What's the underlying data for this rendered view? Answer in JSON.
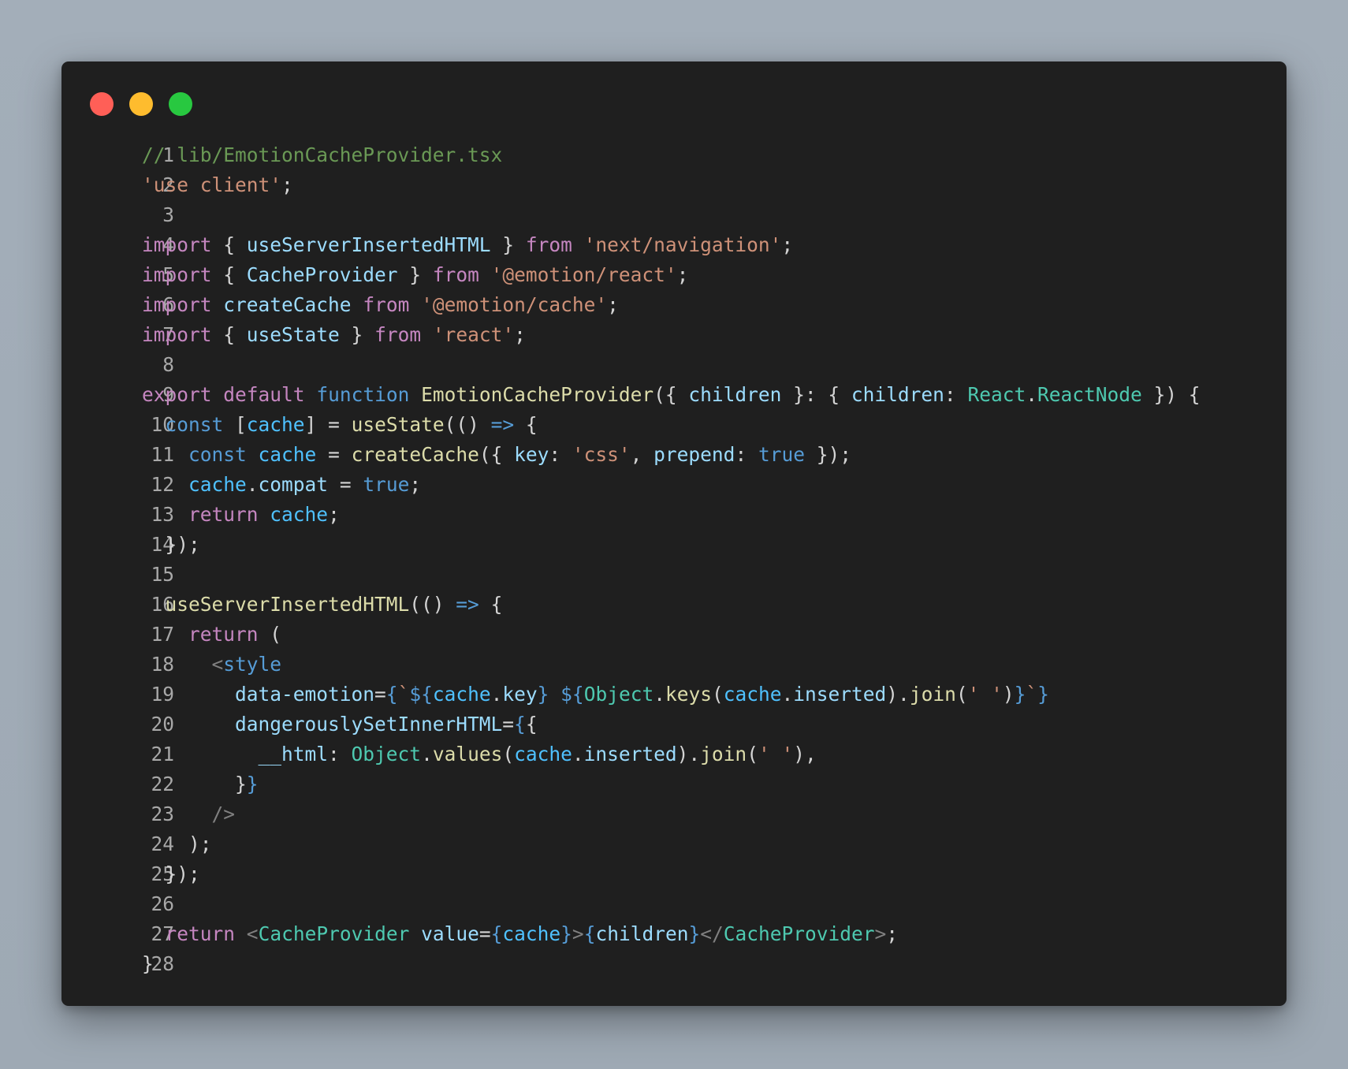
{
  "window": {
    "controls": [
      {
        "name": "close",
        "color": "#ff5f57"
      },
      {
        "name": "minimize",
        "color": "#febc2e"
      },
      {
        "name": "maximize",
        "color": "#28c840"
      }
    ]
  },
  "code": {
    "language": "tsx",
    "lines": [
      {
        "n": "1",
        "tokens": [
          [
            "comment",
            "// lib/EmotionCacheProvider.tsx"
          ]
        ]
      },
      {
        "n": "2",
        "tokens": [
          [
            "string",
            "'use client'"
          ],
          [
            "punct",
            ";"
          ]
        ]
      },
      {
        "n": "3",
        "tokens": []
      },
      {
        "n": "4",
        "tokens": [
          [
            "kw",
            "import"
          ],
          [
            "punct",
            " { "
          ],
          [
            "var",
            "useServerInsertedHTML"
          ],
          [
            "punct",
            " } "
          ],
          [
            "kw",
            "from"
          ],
          [
            "punct",
            " "
          ],
          [
            "string",
            "'next/navigation'"
          ],
          [
            "punct",
            ";"
          ]
        ]
      },
      {
        "n": "5",
        "tokens": [
          [
            "kw",
            "import"
          ],
          [
            "punct",
            " { "
          ],
          [
            "var",
            "CacheProvider"
          ],
          [
            "punct",
            " } "
          ],
          [
            "kw",
            "from"
          ],
          [
            "punct",
            " "
          ],
          [
            "string",
            "'@emotion/react'"
          ],
          [
            "punct",
            ";"
          ]
        ]
      },
      {
        "n": "6",
        "tokens": [
          [
            "kw",
            "import"
          ],
          [
            "punct",
            " "
          ],
          [
            "var",
            "createCache"
          ],
          [
            "punct",
            " "
          ],
          [
            "kw",
            "from"
          ],
          [
            "punct",
            " "
          ],
          [
            "string",
            "'@emotion/cache'"
          ],
          [
            "punct",
            ";"
          ]
        ]
      },
      {
        "n": "7",
        "tokens": [
          [
            "kw",
            "import"
          ],
          [
            "punct",
            " { "
          ],
          [
            "var",
            "useState"
          ],
          [
            "punct",
            " } "
          ],
          [
            "kw",
            "from"
          ],
          [
            "punct",
            " "
          ],
          [
            "string",
            "'react'"
          ],
          [
            "punct",
            ";"
          ]
        ]
      },
      {
        "n": "8",
        "tokens": []
      },
      {
        "n": "9",
        "tokens": [
          [
            "kw",
            "export"
          ],
          [
            "punct",
            " "
          ],
          [
            "kw",
            "default"
          ],
          [
            "punct",
            " "
          ],
          [
            "storage",
            "function"
          ],
          [
            "punct",
            " "
          ],
          [
            "func",
            "EmotionCacheProvider"
          ],
          [
            "punct",
            "({ "
          ],
          [
            "var",
            "children"
          ],
          [
            "punct",
            " }: { "
          ],
          [
            "var",
            "children"
          ],
          [
            "punct",
            ": "
          ],
          [
            "type",
            "React"
          ],
          [
            "punct",
            "."
          ],
          [
            "type",
            "ReactNode"
          ],
          [
            "punct",
            " }) {"
          ]
        ]
      },
      {
        "n": "10",
        "tokens": [
          [
            "punct",
            "  "
          ],
          [
            "storage",
            "const"
          ],
          [
            "punct",
            " ["
          ],
          [
            "const",
            "cache"
          ],
          [
            "punct",
            "] = "
          ],
          [
            "func",
            "useState"
          ],
          [
            "punct",
            "(() "
          ],
          [
            "storage",
            "=>"
          ],
          [
            "punct",
            " {"
          ]
        ]
      },
      {
        "n": "11",
        "tokens": [
          [
            "punct",
            "    "
          ],
          [
            "storage",
            "const"
          ],
          [
            "punct",
            " "
          ],
          [
            "const",
            "cache"
          ],
          [
            "punct",
            " = "
          ],
          [
            "func",
            "createCache"
          ],
          [
            "punct",
            "({ "
          ],
          [
            "var",
            "key"
          ],
          [
            "punct",
            ": "
          ],
          [
            "string",
            "'css'"
          ],
          [
            "punct",
            ", "
          ],
          [
            "var",
            "prepend"
          ],
          [
            "punct",
            ": "
          ],
          [
            "storage",
            "true"
          ],
          [
            "punct",
            " });"
          ]
        ]
      },
      {
        "n": "12",
        "tokens": [
          [
            "punct",
            "    "
          ],
          [
            "const",
            "cache"
          ],
          [
            "punct",
            "."
          ],
          [
            "var",
            "compat"
          ],
          [
            "punct",
            " = "
          ],
          [
            "storage",
            "true"
          ],
          [
            "punct",
            ";"
          ]
        ]
      },
      {
        "n": "13",
        "tokens": [
          [
            "punct",
            "    "
          ],
          [
            "kw",
            "return"
          ],
          [
            "punct",
            " "
          ],
          [
            "const",
            "cache"
          ],
          [
            "punct",
            ";"
          ]
        ]
      },
      {
        "n": "14",
        "tokens": [
          [
            "punct",
            "  });"
          ]
        ]
      },
      {
        "n": "15",
        "tokens": []
      },
      {
        "n": "16",
        "tokens": [
          [
            "punct",
            "  "
          ],
          [
            "func",
            "useServerInsertedHTML"
          ],
          [
            "punct",
            "(() "
          ],
          [
            "storage",
            "=>"
          ],
          [
            "punct",
            " {"
          ]
        ]
      },
      {
        "n": "17",
        "tokens": [
          [
            "punct",
            "    "
          ],
          [
            "kw",
            "return"
          ],
          [
            "punct",
            " ("
          ]
        ]
      },
      {
        "n": "18",
        "tokens": [
          [
            "punct",
            "      "
          ],
          [
            "tag",
            "<"
          ],
          [
            "storage",
            "style"
          ]
        ]
      },
      {
        "n": "19",
        "tokens": [
          [
            "punct",
            "        "
          ],
          [
            "var",
            "data-emotion"
          ],
          [
            "punct",
            "="
          ],
          [
            "brace",
            "{"
          ],
          [
            "string",
            "`"
          ],
          [
            "brace",
            "${"
          ],
          [
            "const",
            "cache"
          ],
          [
            "punct",
            "."
          ],
          [
            "var",
            "key"
          ],
          [
            "brace",
            "}"
          ],
          [
            "string",
            " "
          ],
          [
            "brace",
            "${"
          ],
          [
            "type",
            "Object"
          ],
          [
            "punct",
            "."
          ],
          [
            "func",
            "keys"
          ],
          [
            "punct",
            "("
          ],
          [
            "const",
            "cache"
          ],
          [
            "punct",
            "."
          ],
          [
            "var",
            "inserted"
          ],
          [
            "punct",
            ")."
          ],
          [
            "func",
            "join"
          ],
          [
            "punct",
            "("
          ],
          [
            "string",
            "' '"
          ],
          [
            "punct",
            ")"
          ],
          [
            "brace",
            "}"
          ],
          [
            "string",
            "`"
          ],
          [
            "brace",
            "}"
          ]
        ]
      },
      {
        "n": "20",
        "tokens": [
          [
            "punct",
            "        "
          ],
          [
            "var",
            "dangerouslySetInnerHTML"
          ],
          [
            "punct",
            "="
          ],
          [
            "brace",
            "{"
          ],
          [
            "punct",
            "{"
          ]
        ]
      },
      {
        "n": "21",
        "tokens": [
          [
            "punct",
            "          "
          ],
          [
            "var",
            "__html"
          ],
          [
            "punct",
            ": "
          ],
          [
            "type",
            "Object"
          ],
          [
            "punct",
            "."
          ],
          [
            "func",
            "values"
          ],
          [
            "punct",
            "("
          ],
          [
            "const",
            "cache"
          ],
          [
            "punct",
            "."
          ],
          [
            "var",
            "inserted"
          ],
          [
            "punct",
            ")."
          ],
          [
            "func",
            "join"
          ],
          [
            "punct",
            "("
          ],
          [
            "string",
            "' '"
          ],
          [
            "punct",
            "),"
          ]
        ]
      },
      {
        "n": "22",
        "tokens": [
          [
            "punct",
            "        }"
          ],
          [
            "brace",
            "}"
          ]
        ]
      },
      {
        "n": "23",
        "tokens": [
          [
            "punct",
            "      "
          ],
          [
            "tag",
            "/>"
          ]
        ]
      },
      {
        "n": "24",
        "tokens": [
          [
            "punct",
            "    );"
          ]
        ]
      },
      {
        "n": "25",
        "tokens": [
          [
            "punct",
            "  });"
          ]
        ]
      },
      {
        "n": "26",
        "tokens": []
      },
      {
        "n": "27",
        "tokens": [
          [
            "punct",
            "  "
          ],
          [
            "kw",
            "return"
          ],
          [
            "punct",
            " "
          ],
          [
            "tag",
            "<"
          ],
          [
            "type",
            "CacheProvider"
          ],
          [
            "punct",
            " "
          ],
          [
            "var",
            "value"
          ],
          [
            "punct",
            "="
          ],
          [
            "brace",
            "{"
          ],
          [
            "const",
            "cache"
          ],
          [
            "brace",
            "}"
          ],
          [
            "tag",
            ">"
          ],
          [
            "brace",
            "{"
          ],
          [
            "var",
            "children"
          ],
          [
            "brace",
            "}"
          ],
          [
            "tag",
            "</"
          ],
          [
            "type",
            "CacheProvider"
          ],
          [
            "tag",
            ">"
          ],
          [
            "punct",
            ";"
          ]
        ]
      },
      {
        "n": "28",
        "tokens": [
          [
            "punct",
            "}"
          ]
        ]
      }
    ]
  }
}
